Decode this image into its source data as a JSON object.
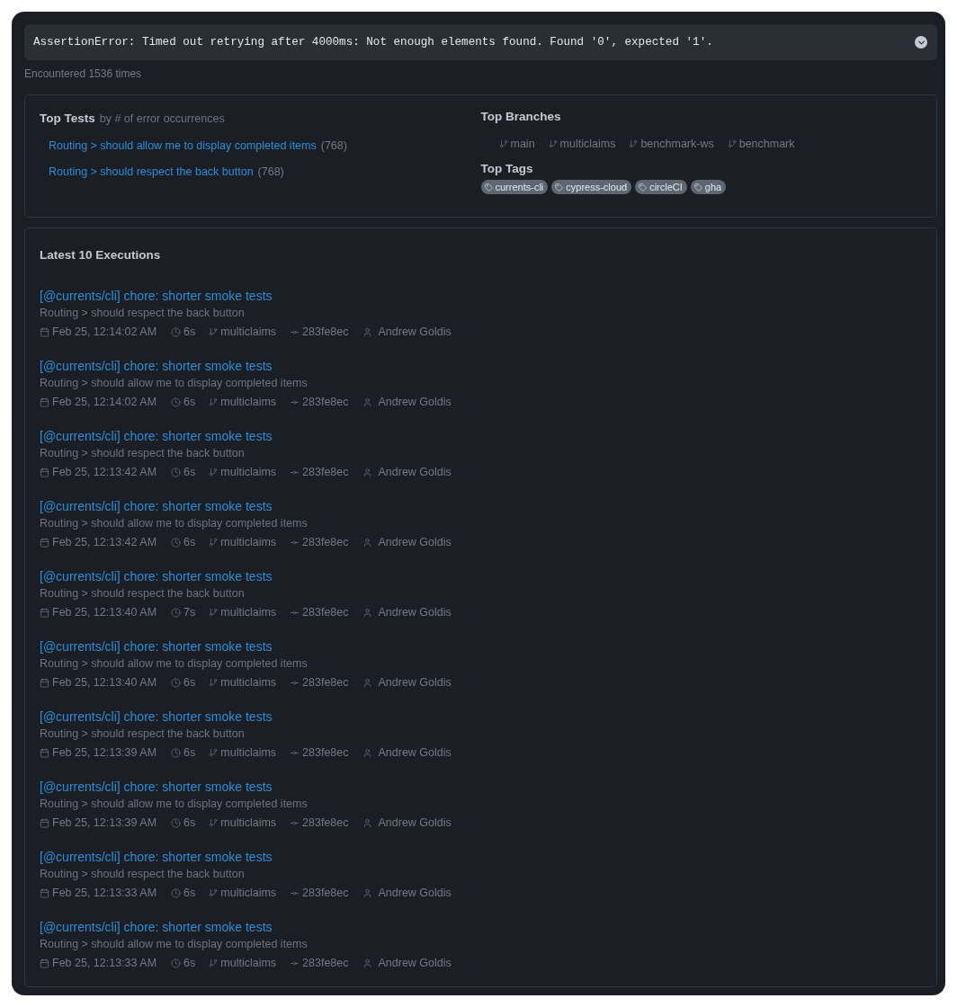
{
  "error": {
    "message": "AssertionError: Timed out retrying after 4000ms: Not enough elements found. Found '0', expected '1'."
  },
  "encountered": "Encountered 1536 times",
  "top_tests": {
    "title": "Top Tests",
    "subtitle": "by # of error occurrences",
    "items": [
      {
        "name": "Routing > should allow me to display completed items",
        "count": "(768)"
      },
      {
        "name": "Routing > should respect the back button",
        "count": "(768)"
      }
    ]
  },
  "top_branches": {
    "title": "Top Branches",
    "items": [
      "main",
      "multiclaims",
      "benchmark-ws",
      "benchmark"
    ]
  },
  "top_tags": {
    "title": "Top Tags",
    "items": [
      "currents-cli",
      "cypress-cloud",
      "circleCI",
      "gha"
    ]
  },
  "executions": {
    "title": "Latest 10 Executions",
    "items": [
      {
        "title": "[@currents/cli] chore: shorter smoke tests",
        "test": "Routing > should respect the back button",
        "date": "Feb 25, 12:14:02 AM",
        "duration": "6s",
        "branch": "multiclaims",
        "commit": "283fe8ec",
        "author": "Andrew Goldis"
      },
      {
        "title": "[@currents/cli] chore: shorter smoke tests",
        "test": "Routing > should allow me to display completed items",
        "date": "Feb 25, 12:14:02 AM",
        "duration": "6s",
        "branch": "multiclaims",
        "commit": "283fe8ec",
        "author": "Andrew Goldis"
      },
      {
        "title": "[@currents/cli] chore: shorter smoke tests",
        "test": "Routing > should respect the back button",
        "date": "Feb 25, 12:13:42 AM",
        "duration": "6s",
        "branch": "multiclaims",
        "commit": "283fe8ec",
        "author": "Andrew Goldis"
      },
      {
        "title": "[@currents/cli] chore: shorter smoke tests",
        "test": "Routing > should allow me to display completed items",
        "date": "Feb 25, 12:13:42 AM",
        "duration": "6s",
        "branch": "multiclaims",
        "commit": "283fe8ec",
        "author": "Andrew Goldis"
      },
      {
        "title": "[@currents/cli] chore: shorter smoke tests",
        "test": "Routing > should respect the back button",
        "date": "Feb 25, 12:13:40 AM",
        "duration": "7s",
        "branch": "multiclaims",
        "commit": "283fe8ec",
        "author": "Andrew Goldis"
      },
      {
        "title": "[@currents/cli] chore: shorter smoke tests",
        "test": "Routing > should allow me to display completed items",
        "date": "Feb 25, 12:13:40 AM",
        "duration": "6s",
        "branch": "multiclaims",
        "commit": "283fe8ec",
        "author": "Andrew Goldis"
      },
      {
        "title": "[@currents/cli] chore: shorter smoke tests",
        "test": "Routing > should respect the back button",
        "date": "Feb 25, 12:13:39 AM",
        "duration": "6s",
        "branch": "multiclaims",
        "commit": "283fe8ec",
        "author": "Andrew Goldis"
      },
      {
        "title": "[@currents/cli] chore: shorter smoke tests",
        "test": "Routing > should allow me to display completed items",
        "date": "Feb 25, 12:13:39 AM",
        "duration": "6s",
        "branch": "multiclaims",
        "commit": "283fe8ec",
        "author": "Andrew Goldis"
      },
      {
        "title": "[@currents/cli] chore: shorter smoke tests",
        "test": "Routing > should respect the back button",
        "date": "Feb 25, 12:13:33 AM",
        "duration": "6s",
        "branch": "multiclaims",
        "commit": "283fe8ec",
        "author": "Andrew Goldis"
      },
      {
        "title": "[@currents/cli] chore: shorter smoke tests",
        "test": "Routing > should allow me to display completed items",
        "date": "Feb 25, 12:13:33 AM",
        "duration": "6s",
        "branch": "multiclaims",
        "commit": "283fe8ec",
        "author": "Andrew Goldis"
      }
    ]
  }
}
